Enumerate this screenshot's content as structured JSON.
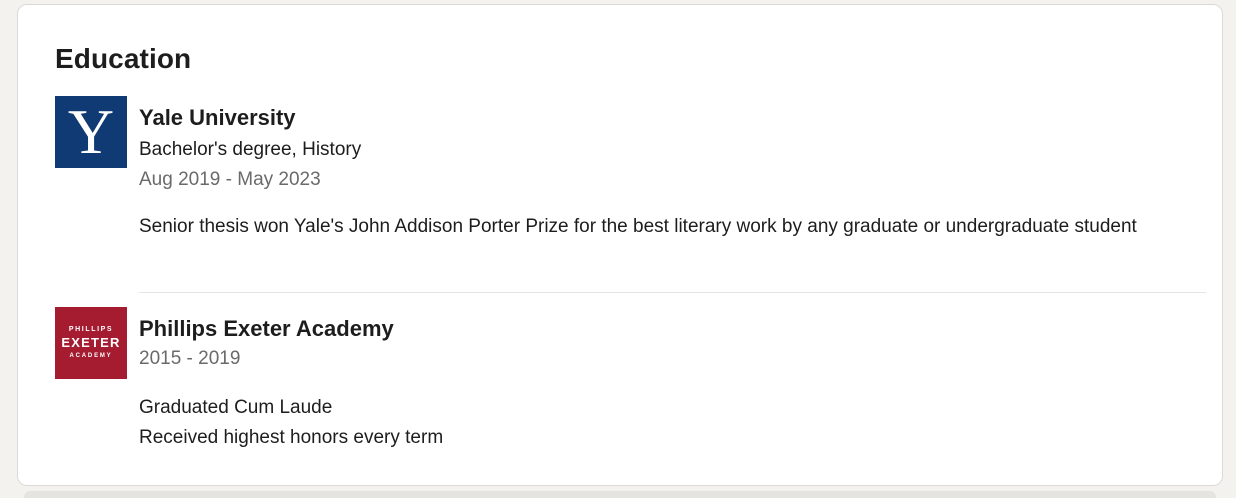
{
  "section": {
    "title": "Education"
  },
  "entries": [
    {
      "school": "Yale University",
      "degree": "Bachelor's degree, History",
      "dates": "Aug 2019 - May 2023",
      "description": [
        "Senior thesis won Yale's John Addison Porter Prize for the best literary work by any graduate or undergraduate student"
      ],
      "logo": {
        "text": "Y",
        "bg_color": "#0f3a73",
        "fg_color": "#ffffff"
      }
    },
    {
      "school": "Phillips Exeter Academy",
      "dates": "2015 - 2019",
      "description": [
        "Graduated Cum Laude",
        "Received highest honors every term"
      ],
      "logo": {
        "line1": "PHILLIPS",
        "line2": "EXETER",
        "line3": "ACADEMY",
        "bg_color": "#a51c30",
        "fg_color": "#ffffff"
      }
    }
  ],
  "colors": {
    "page_bg": "#f3f2ef",
    "card_bg": "#ffffff",
    "text": "#1d1d1d",
    "muted_text": "#6a6a6a",
    "divider": "#e6e4e0"
  }
}
